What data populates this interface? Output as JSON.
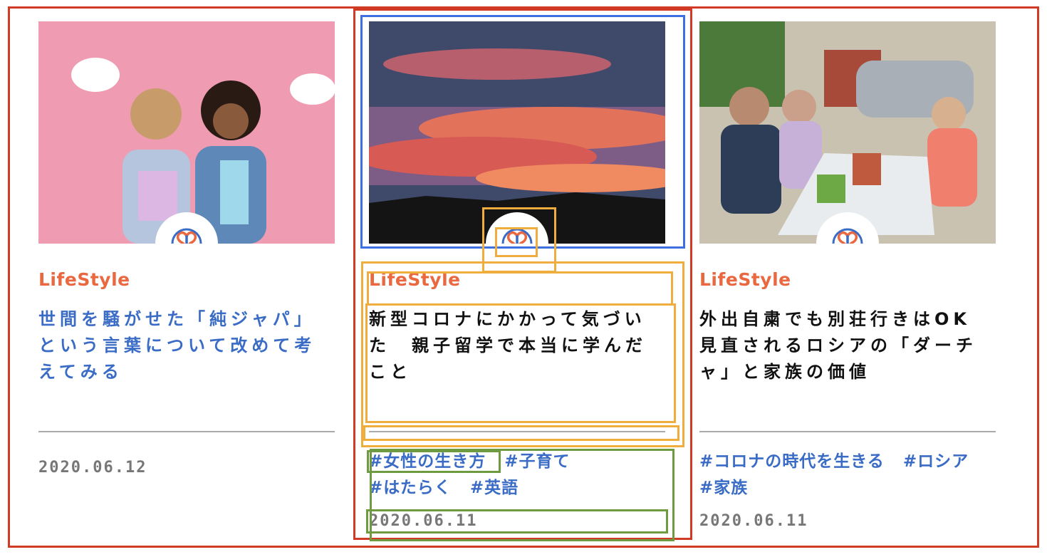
{
  "colors": {
    "category": "#e9683f",
    "link": "#3a6cc6",
    "date": "#777777",
    "annotation_red": "#d13a24",
    "annotation_blue": "#3d6fe0",
    "annotation_orange": "#efad3d",
    "annotation_green": "#6e9a40"
  },
  "logo_icon": "heart-leaf-logo-icon",
  "cards": [
    {
      "image_alt": "Two women holding speech bubbles on a pink background",
      "category": "LifeStyle",
      "title": "世間を騒がせた「純ジャパ」という言葉について改めて考えてみる",
      "tags": [],
      "date": "2020.06.12"
    },
    {
      "image_alt": "Red sunset sky over dark hills",
      "category": "LifeStyle",
      "title": "新型コロナにかかって気づいた　親子留学で本当に学んだこと",
      "tags": [
        "#女性の生き方",
        "#子育て",
        "#はたらく",
        "#英語"
      ],
      "date": "2020.06.11"
    },
    {
      "image_alt": "Family eating outdoors at a dacha table",
      "category": "LifeStyle",
      "title": "外出自粛でも別荘行きはOK　見直されるロシアの「ダーチャ」と家族の価値",
      "tags": [
        "#コロナの時代を生きる",
        "#ロシア",
        "#家族"
      ],
      "date": "2020.06.11"
    }
  ]
}
